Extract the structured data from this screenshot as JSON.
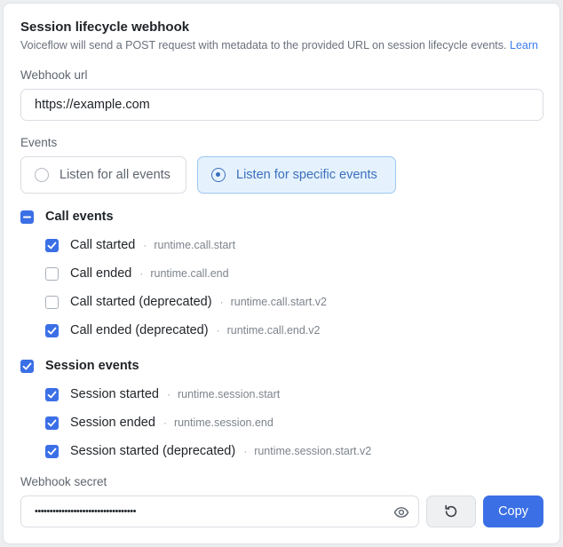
{
  "header": {
    "title": "Session lifecycle webhook",
    "description": "Voiceflow will send a POST request with metadata to the provided URL on session lifecycle events.",
    "learn_label": "Learn"
  },
  "webhook_url": {
    "label": "Webhook url",
    "value": "https://example.com"
  },
  "events": {
    "label": "Events",
    "mode_options": [
      {
        "label": "Listen for all events",
        "selected": false
      },
      {
        "label": "Listen for specific events",
        "selected": true
      }
    ],
    "separator": "·",
    "groups": [
      {
        "label": "Call events",
        "state": "partial",
        "items": [
          {
            "label": "Call started",
            "key": "runtime.call.start",
            "checked": true
          },
          {
            "label": "Call ended",
            "key": "runtime.call.end",
            "checked": false
          },
          {
            "label": "Call started (deprecated)",
            "key": "runtime.call.start.v2",
            "checked": false
          },
          {
            "label": "Call ended (deprecated)",
            "key": "runtime.call.end.v2",
            "checked": true
          }
        ]
      },
      {
        "label": "Session events",
        "state": "checked",
        "items": [
          {
            "label": "Session started",
            "key": "runtime.session.start",
            "checked": true
          },
          {
            "label": "Session ended",
            "key": "runtime.session.end",
            "checked": true
          },
          {
            "label": "Session started (deprecated)",
            "key": "runtime.session.start.v2",
            "checked": true
          }
        ]
      }
    ]
  },
  "webhook_secret": {
    "label": "Webhook secret",
    "masked_value": "••••••••••••••••••••••••••••••••••",
    "reveal_icon": "eye-icon",
    "regenerate_icon": "refresh-icon",
    "copy_label": "Copy"
  },
  "colors": {
    "accent": "#3b6fe6",
    "link": "#3b7cf0",
    "selected_bg": "#e5f2fd",
    "selected_border": "#9cc7ef"
  }
}
